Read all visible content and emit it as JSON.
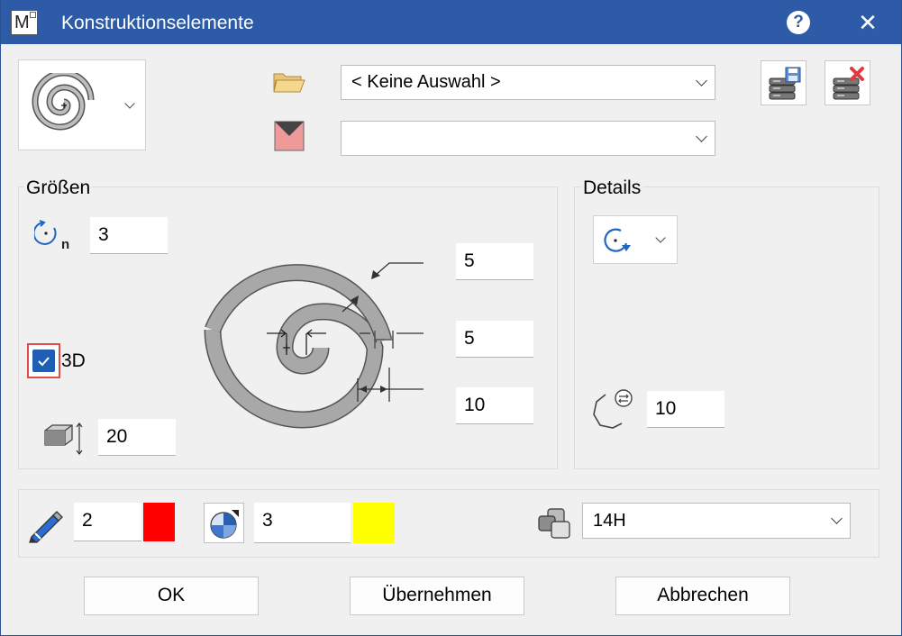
{
  "titlebar": {
    "app_icon_letter": "M",
    "title": "Konstruktionselemente",
    "help_label": "?",
    "close_label": "✕"
  },
  "top": {
    "element_picker_icon": "spiral-icon",
    "folder_icon": "folder-open-icon",
    "selection_value": "< Keine Auswahl >",
    "subtype_icon": "envelope-icon",
    "subtype_value": "",
    "save_db_icon": "database-save-icon",
    "delete_db_icon": "database-delete-icon"
  },
  "groessen": {
    "label": "Größen",
    "turns_icon": "turns-n-icon",
    "turns_value": "3",
    "checkbox_3d_label": "3D",
    "checkbox_3d_checked": true,
    "height_icon": "height-block-icon",
    "height_value": "20",
    "dim_outer_value": "5",
    "dim_pitch_value": "5",
    "dim_width_value": "10"
  },
  "details": {
    "label": "Details",
    "direction_icon": "rotation-direction-icon",
    "segments_icon": "polygon-segments-icon",
    "segments_value": "10"
  },
  "attributes": {
    "pen_icon": "pen-icon",
    "pen_value": "2",
    "pen_color": "#ff0000",
    "pattern_icon": "pie-pattern-icon",
    "pattern_value": "3",
    "pattern_color": "#ffff00",
    "layer_icon": "layer-icon",
    "layer_value": "14H"
  },
  "buttons": {
    "ok": "OK",
    "apply": "Übernehmen",
    "cancel": "Abbrechen"
  }
}
